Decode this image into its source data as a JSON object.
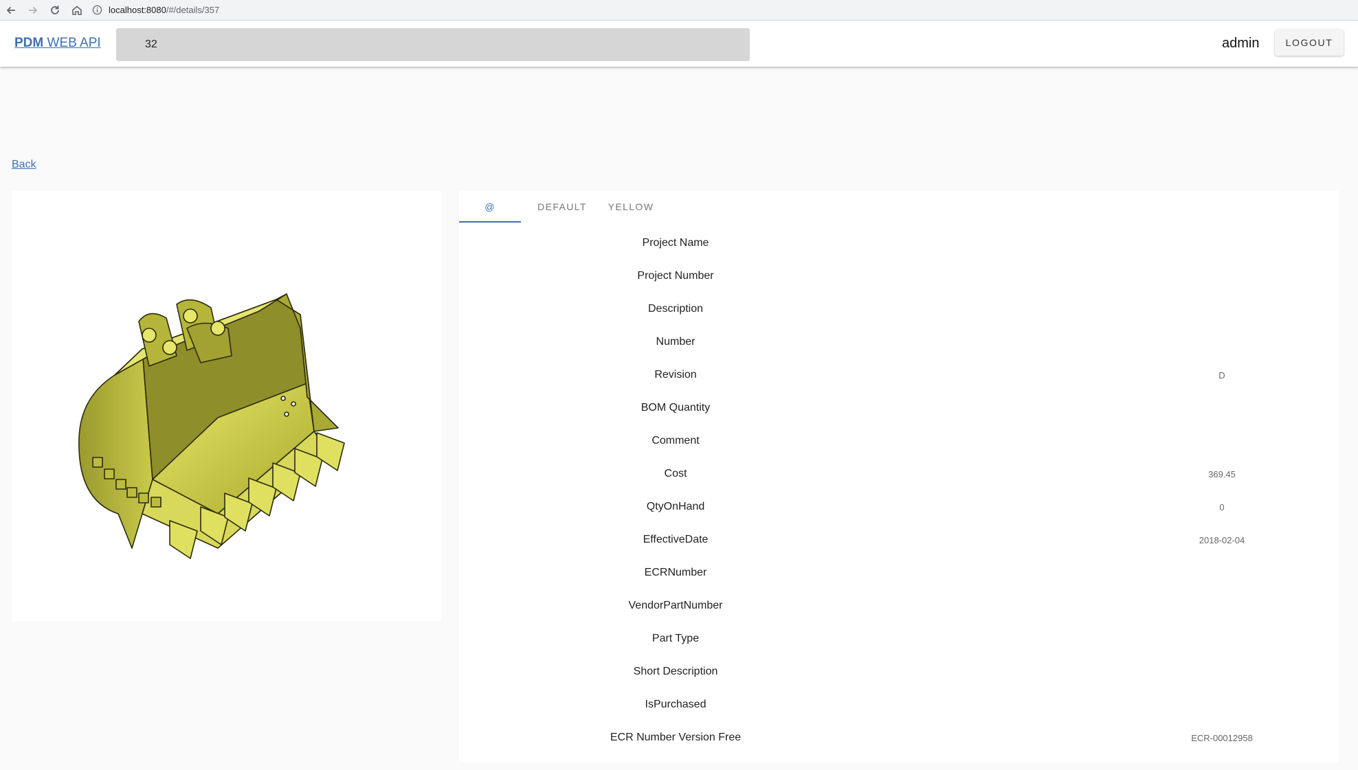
{
  "browser": {
    "url_host": "localhost:8080",
    "url_path": "/#/details/357"
  },
  "header": {
    "brand_bold": "PDM",
    "brand_rest": "WEB API",
    "search_value": "32",
    "username": "admin",
    "logout_label": "LOGOUT"
  },
  "back_label": "Back",
  "tabs": [
    {
      "label": "@",
      "active": true
    },
    {
      "label": "DEFAULT",
      "active": false
    },
    {
      "label": "YELLOW",
      "active": false
    }
  ],
  "properties": [
    {
      "name": "Project Name",
      "value": ""
    },
    {
      "name": "Project Number",
      "value": ""
    },
    {
      "name": "Description",
      "value": ""
    },
    {
      "name": "Number",
      "value": ""
    },
    {
      "name": "Revision",
      "value": "D"
    },
    {
      "name": "BOM Quantity",
      "value": ""
    },
    {
      "name": "Comment",
      "value": ""
    },
    {
      "name": "Cost",
      "value": "369.45"
    },
    {
      "name": "QtyOnHand",
      "value": "0"
    },
    {
      "name": "EffectiveDate",
      "value": "2018-02-04"
    },
    {
      "name": "ECRNumber",
      "value": ""
    },
    {
      "name": "VendorPartNumber",
      "value": ""
    },
    {
      "name": "Part Type",
      "value": ""
    },
    {
      "name": "Short Description",
      "value": ""
    },
    {
      "name": "IsPurchased",
      "value": ""
    },
    {
      "name": "ECR Number Version Free",
      "value": "ECR-00012958"
    }
  ],
  "colors": {
    "accent": "#3f6fb0",
    "model_yellow": "#c8c83c"
  },
  "icons": [
    "back-arrow-icon",
    "forward-arrow-icon",
    "reload-icon",
    "home-icon",
    "info-icon"
  ]
}
